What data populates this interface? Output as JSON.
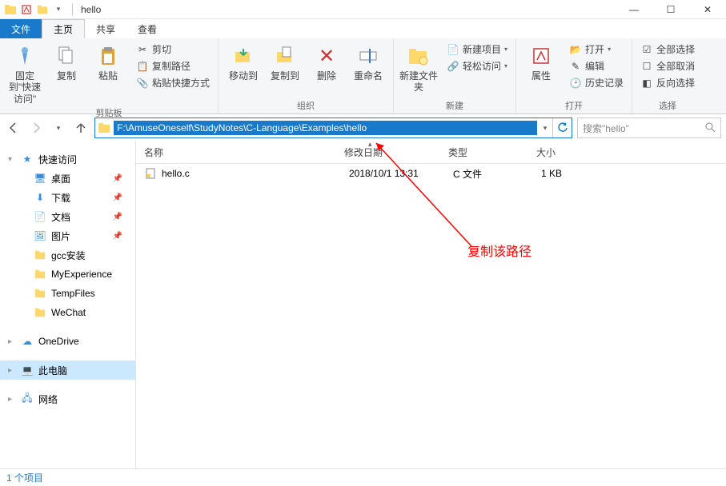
{
  "window": {
    "title": "hello",
    "minimize": "—",
    "maximize": "☐",
    "close": "✕"
  },
  "tabs": {
    "file": "文件",
    "home": "主页",
    "share": "共享",
    "view": "查看"
  },
  "ribbon": {
    "pin": "固定到\"快速访问\"",
    "copy": "复制",
    "paste": "粘贴",
    "cut": "剪切",
    "copyPath": "复制路径",
    "pasteShortcut": "粘贴快捷方式",
    "groupClipboard": "剪贴板",
    "moveTo": "移动到",
    "copyTo": "复制到",
    "delete": "删除",
    "rename": "重命名",
    "groupOrganize": "组织",
    "newFolder": "新建文件夹",
    "newItem": "新建项目",
    "easyAccess": "轻松访问",
    "groupNew": "新建",
    "properties": "属性",
    "open": "打开",
    "edit": "编辑",
    "history": "历史记录",
    "groupOpen": "打开",
    "selectAll": "全部选择",
    "selectNone": "全部取消",
    "invertSelection": "反向选择",
    "groupSelect": "选择"
  },
  "nav": {
    "path": "F:\\AmuseOneself\\StudyNotes\\C-Language\\Examples\\hello",
    "searchPlaceholder": "搜索\"hello\""
  },
  "columns": {
    "name": "名称",
    "date": "修改日期",
    "type": "类型",
    "size": "大小"
  },
  "files": [
    {
      "name": "hello.c",
      "date": "2018/10/1 13:31",
      "type": "C 文件",
      "size": "1 KB"
    }
  ],
  "sidebar": {
    "quickAccess": "快速访问",
    "desktop": "桌面",
    "downloads": "下载",
    "documents": "文档",
    "pictures": "图片",
    "gcc": "gcc安装",
    "myexp": "MyExperience",
    "temp": "TempFiles",
    "wechat": "WeChat",
    "onedrive": "OneDrive",
    "thispc": "此电脑",
    "network": "网络"
  },
  "annotation": "复制该路径",
  "status": {
    "items": "1 个项目"
  }
}
